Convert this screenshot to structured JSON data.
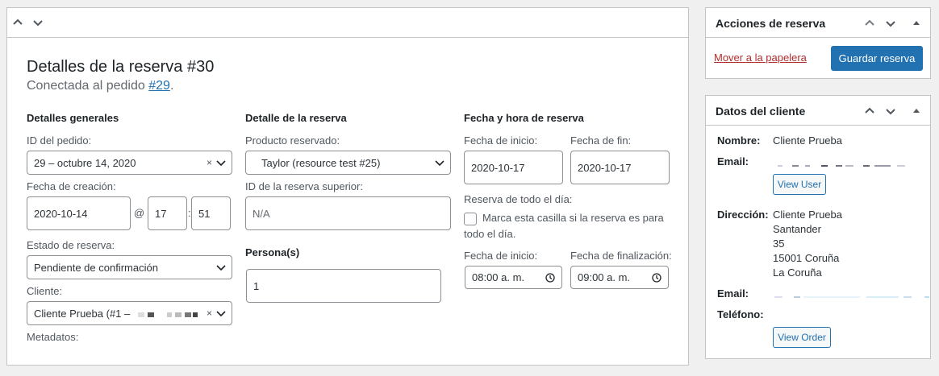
{
  "main": {
    "title": "Detalles de la reserva #30",
    "subtitle_prefix": "Conectada al pedido ",
    "order_link": "#29",
    "subtitle_suffix": ".",
    "general": {
      "heading": "Detalles generales",
      "order_id_label": "ID del pedido:",
      "order_id_value": "29 – octubre 14, 2020",
      "created_label": "Fecha de creación:",
      "created_date": "2020-10-14",
      "at": "@",
      "created_hour": "17",
      "colon": ":",
      "created_minute": "51",
      "status_label": "Estado de reserva:",
      "status_value": "Pendiente de confirmación",
      "customer_label": "Cliente:",
      "customer_value": "Cliente Prueba (#1 –",
      "meta_label": "Metadatos:"
    },
    "reservation": {
      "heading": "Detalle de la reserva",
      "product_label": "Producto reservado:",
      "product_value": "Taylor (resource test #25)",
      "parent_label": "ID de la reserva superior:",
      "parent_placeholder": "N/A",
      "persons_label": "Persona(s)",
      "persons_value": "1"
    },
    "datetime": {
      "heading": "Fecha y hora de reserva",
      "start_label": "Fecha de inicio:",
      "start_value": "2020-10-17",
      "end_label": "Fecha de fin:",
      "end_value": "2020-10-17",
      "allday_label": "Reserva de todo el día:",
      "allday_text_1": "Marca esta casilla si la reserva es para",
      "allday_text_2": "todo el día.",
      "start_time_label": "Fecha de inicio:",
      "start_time_value": "08:00 a. m.",
      "end_time_label": "Fecha de finalización:",
      "end_time_value": "09:00 a. m."
    }
  },
  "actions": {
    "title": "Acciones de reserva",
    "trash": "Mover a la papelera",
    "save": "Guardar reserva"
  },
  "customer": {
    "title": "Datos del cliente",
    "name_label": "Nombre:",
    "name_value": "Cliente Prueba",
    "email_label": "Email:",
    "view_user": "View User",
    "address_label": "Dirección:",
    "address_lines": [
      "Cliente Prueba",
      "Santander",
      "35",
      "15001 Coruña",
      "La Coruña"
    ],
    "email2_label": "Email:",
    "phone_label": "Teléfono:",
    "view_order": "View Order"
  },
  "colors": {
    "primary": "#2271b1",
    "danger": "#b32d2e",
    "border": "#c3c4c7"
  }
}
